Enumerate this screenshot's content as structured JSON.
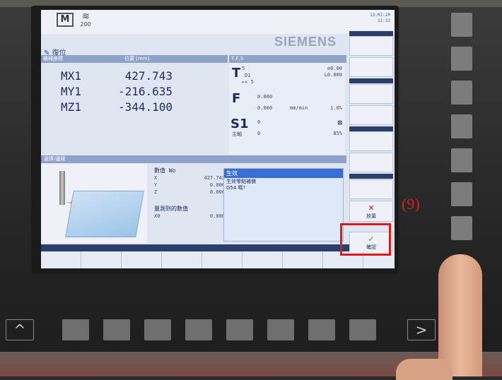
{
  "screen": {
    "logo_m": "M",
    "logo_sub": "200",
    "clock": [
      "13:02:20",
      "11:33"
    ],
    "brand": "SIEMENS",
    "title": "復位",
    "header_left": "機械座標",
    "header_pos": "位置 [mm]",
    "header_right": "T,F,S"
  },
  "axes": [
    {
      "name": "MX1",
      "value": "427.743"
    },
    {
      "name": "MY1",
      "value": "-216.635"
    },
    {
      "name": "MZ1",
      "value": "-344.100"
    }
  ],
  "tfs": {
    "t_label": "T",
    "t_num": "5",
    "t_d": "D1",
    "t_next": "▸▸ 5",
    "t_r": "⌀0.00",
    "t_l": "L0.000",
    "f_label": "F",
    "f_v1": "0.000",
    "f_v2": "0.000",
    "f_unit": "mm/min",
    "f_pct": "1.0%",
    "s_label": "S1",
    "s_v": "0",
    "s_main": "主軸",
    "s_v2": "0",
    "s_pct": "85%"
  },
  "select": {
    "header": "選擇/邊緣",
    "value_label": "數值 Wo",
    "x_label": "X",
    "x_val": "427.743",
    "y_label": "Y",
    "y_val": "0.000",
    "z_label": "Z",
    "z_val": "0.000",
    "measured_label": "量測到的數值",
    "x0_label": "X0",
    "x0_val": "0.000"
  },
  "dialog": {
    "title": "生效",
    "line1": "生效零點補償",
    "line2": "G54 嗎?"
  },
  "softkeys": {
    "cancel": "放棄",
    "ok": "確認"
  },
  "annotation": "(9)",
  "keys": {
    "up": "^",
    "right": ">"
  }
}
